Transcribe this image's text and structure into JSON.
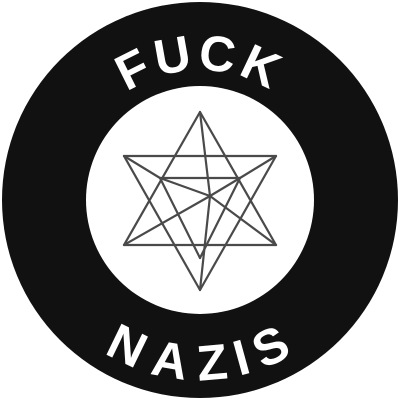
{
  "badge": {
    "top_text": "FUCK",
    "bottom_text": "NAZIS",
    "colors": {
      "ring": "#111111",
      "center": "#ffffff",
      "text": "#ffffff",
      "symbol": "#4a4a4a",
      "page": "#ffffff"
    },
    "center_symbol": "star-tetrahedron-icon"
  }
}
